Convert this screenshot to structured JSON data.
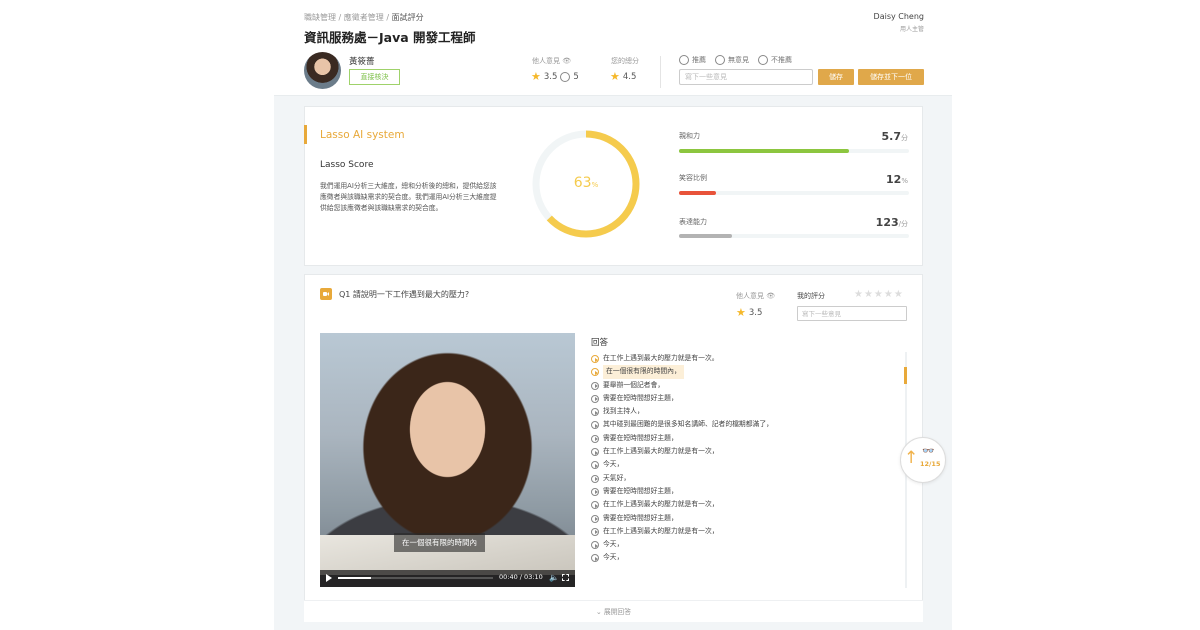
{
  "header": {
    "breadcrumb": [
      "職缺管理",
      "應徵者管理",
      "面試評分"
    ],
    "breadcrumb_sep": "/",
    "title": "資訊服務處－Java 開發工程師",
    "user": {
      "name": "Daisy Cheng",
      "role": "用人主管"
    }
  },
  "candidate": {
    "name": "黃筱薔",
    "approve_label": "直接核決",
    "others_label": "他人意見",
    "others_rating": "3.5",
    "others_count": "5",
    "your_total_label": "您的總分",
    "your_total": "4.5",
    "recommend_options": [
      "推薦",
      "無意見",
      "不推薦"
    ],
    "comment_placeholder": "寫下一些意見",
    "save_label": "儲存",
    "save_next_label": "儲存並下一位"
  },
  "ai": {
    "title": "Lasso AI system",
    "score_title": "Lasso Score",
    "description": "我們運用AI分析三大維度，總和分析後的總和，提供給您該應徵者與該職缺需求的契合度。我們運用AI分析三大維度提供給您該應徵者與該職缺需求的契合度。",
    "score_percent": 63,
    "score_text": "63",
    "score_unit": "%",
    "accent_color": "#f5cb4d",
    "metrics": [
      {
        "label": "親和力",
        "value": "5.7",
        "unit": "分",
        "fraction": 0.74,
        "color": "#8cc63f"
      },
      {
        "label": "笑容比例",
        "value": "12",
        "unit": "%",
        "fraction": 0.16,
        "color": "#e8533a"
      },
      {
        "label": "表達能力",
        "value": "123",
        "unit": "/分",
        "fraction": 0.23,
        "color": "#b3b3b3"
      }
    ]
  },
  "question": {
    "text": "Q1  請說明一下工作遇到最大的壓力?",
    "others_label": "他人意見",
    "others_rating": "3.5",
    "my_score_label": "我的評分",
    "my_stars": 0,
    "stars_glyph": "★★★★★",
    "comment_placeholder": "寫下一些意見",
    "video": {
      "subtitle": "在一個很有限的時間內",
      "time": "00:40 / 03:10",
      "progress": 0.21
    },
    "answer_title": "回答",
    "answers": [
      "在工作上遇到最大的壓力就是有一次。",
      "在一個很有限的時間內，",
      "要舉辦一個記者會，",
      "需要在短時間想好主題，",
      "找到主持人，",
      "其中碰到最困難的是很多知名講師、記者的檔期都滿了，",
      "需要在短時間想好主題，",
      "在工作上遇到最大的壓力就是有一次，",
      "今天，",
      "天氣好，",
      "需要在短時間想好主題，",
      "在工作上遇到最大的壓力就是有一次，",
      "需要在短時間想好主題，",
      "在工作上遇到最大的壓力就是有一次，",
      "今天，",
      "今天，"
    ],
    "active_index": [
      0,
      1
    ],
    "highlight_index": 1,
    "progress_badge": "12/15",
    "expand_label": "展開回答"
  }
}
